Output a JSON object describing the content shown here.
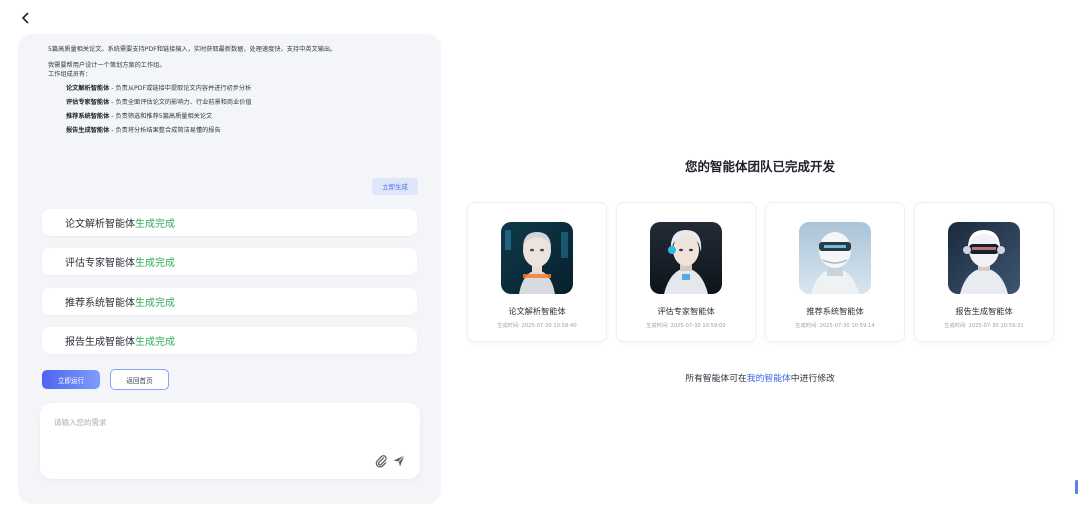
{
  "header": {
    "back_icon": "chevron-left-icon"
  },
  "chat": {
    "prompt_line1": "5篇高质量相关论文。系统需要支持PDF和链接输入，实时获取最新数据，处理速度快，支持中英文输出。",
    "prompt_line2": "我需要帮用户设计一个策划方案的工作组。",
    "prompt_line3": "工作组成员有：",
    "members": [
      {
        "name": "论文解析智能体",
        "desc": " - 负责从PDF或链接中提取论文内容并进行初步分析"
      },
      {
        "name": "评估专家智能体",
        "desc": " - 负责全面评估论文的影响力、行业前景和商业价值"
      },
      {
        "name": "推荐系统智能体",
        "desc": " - 负责筛选和推荐5篇高质量相关论文"
      },
      {
        "name": "报告生成智能体",
        "desc": " - 负责将分析结果整合成简洁易懂的报告"
      }
    ],
    "generate_chip": "立即生成",
    "status_items": [
      {
        "name": "论文解析智能体",
        "status": "生成完成"
      },
      {
        "name": "评估专家智能体",
        "status": "生成完成"
      },
      {
        "name": "推荐系统智能体",
        "status": "生成完成"
      },
      {
        "name": "报告生成智能体",
        "status": "生成完成"
      }
    ],
    "run_button": "立即运行",
    "home_button": "返回首页",
    "input_placeholder": "请输入您的需求",
    "input_value": ""
  },
  "team": {
    "title": "您的智能体团队已完成开发",
    "agents": [
      {
        "name": "论文解析智能体",
        "time": "生成时间: 2025-07-30 10:58:40"
      },
      {
        "name": "评估专家智能体",
        "time": "生成时间: 2025-07-30 10:59:00"
      },
      {
        "name": "推荐系统智能体",
        "time": "生成时间: 2025-07-30 10:59:14"
      },
      {
        "name": "报告生成智能体",
        "time": "生成时间: 2025-07-30 10:59:31"
      }
    ],
    "note_prefix": "所有智能体可在",
    "note_link": "我的智能体",
    "note_suffix": "中进行修改"
  },
  "colors": {
    "accent": "#3c67e8",
    "success": "#2fae5b",
    "panel_bg": "#f3f5f8"
  }
}
